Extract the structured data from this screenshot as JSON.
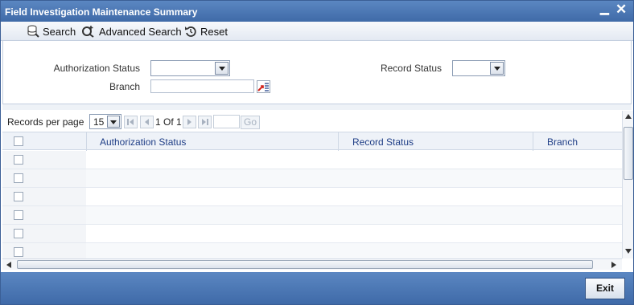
{
  "window": {
    "title": "Field Investigation Maintenance Summary"
  },
  "toolbar": {
    "search_label": "Search",
    "advanced_search_label": "Advanced Search",
    "reset_label": "Reset"
  },
  "criteria": {
    "authorization_status_label": "Authorization Status",
    "authorization_status_value": "",
    "record_status_label": "Record Status",
    "record_status_value": "",
    "branch_label": "Branch",
    "branch_value": ""
  },
  "pager": {
    "records_per_page_label": "Records per page",
    "records_per_page_value": "15",
    "page_text": "1 Of 1",
    "go_label": "Go"
  },
  "grid": {
    "columns": [
      "Authorization Status",
      "Record Status",
      "Branch"
    ],
    "rows": [
      {},
      {},
      {},
      {},
      {},
      {}
    ]
  },
  "footer": {
    "exit_label": "Exit"
  },
  "colors": {
    "titlebar": "#4f7bb8",
    "header_text": "#1f3e86"
  },
  "icons": [
    "search-icon",
    "advanced-search-icon",
    "reset-icon",
    "lov-icon",
    "minimize-icon",
    "close-icon"
  ]
}
